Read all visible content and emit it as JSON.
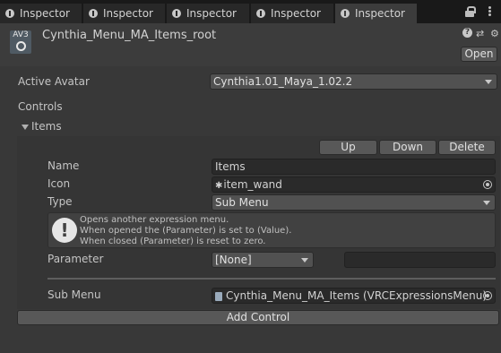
{
  "tabs": [
    {
      "label": "Inspector",
      "active": false
    },
    {
      "label": "Inspector",
      "active": false
    },
    {
      "label": "Inspector",
      "active": false
    },
    {
      "label": "Inspector",
      "active": false
    },
    {
      "label": "Inspector",
      "active": true
    }
  ],
  "header": {
    "icon_text": "AV3",
    "title": "Cynthia_Menu_MA_Items_root",
    "open_label": "Open"
  },
  "avatar": {
    "label": "Active Avatar",
    "value": "Cynthia1.01_Maya_1.02.2"
  },
  "controls": {
    "label": "Controls",
    "foldout_label": "Items",
    "up_label": "Up",
    "down_label": "Down",
    "delete_label": "Delete",
    "name_label": "Name",
    "name_value": "Items",
    "icon_label": "Icon",
    "icon_value": "item_wand",
    "type_label": "Type",
    "type_value": "Sub Menu",
    "info_lines": [
      "Opens another expression menu.",
      "When opened the (Parameter) is set to (Value).",
      "When closed (Parameter) is reset to zero."
    ],
    "parameter_label": "Parameter",
    "parameter_value": "[None]",
    "parameter_extra": "",
    "submenu_label": "Sub Menu",
    "submenu_value": "Cynthia_Menu_MA_Items (VRCExpressionsMenu)",
    "add_label": "Add Control"
  }
}
